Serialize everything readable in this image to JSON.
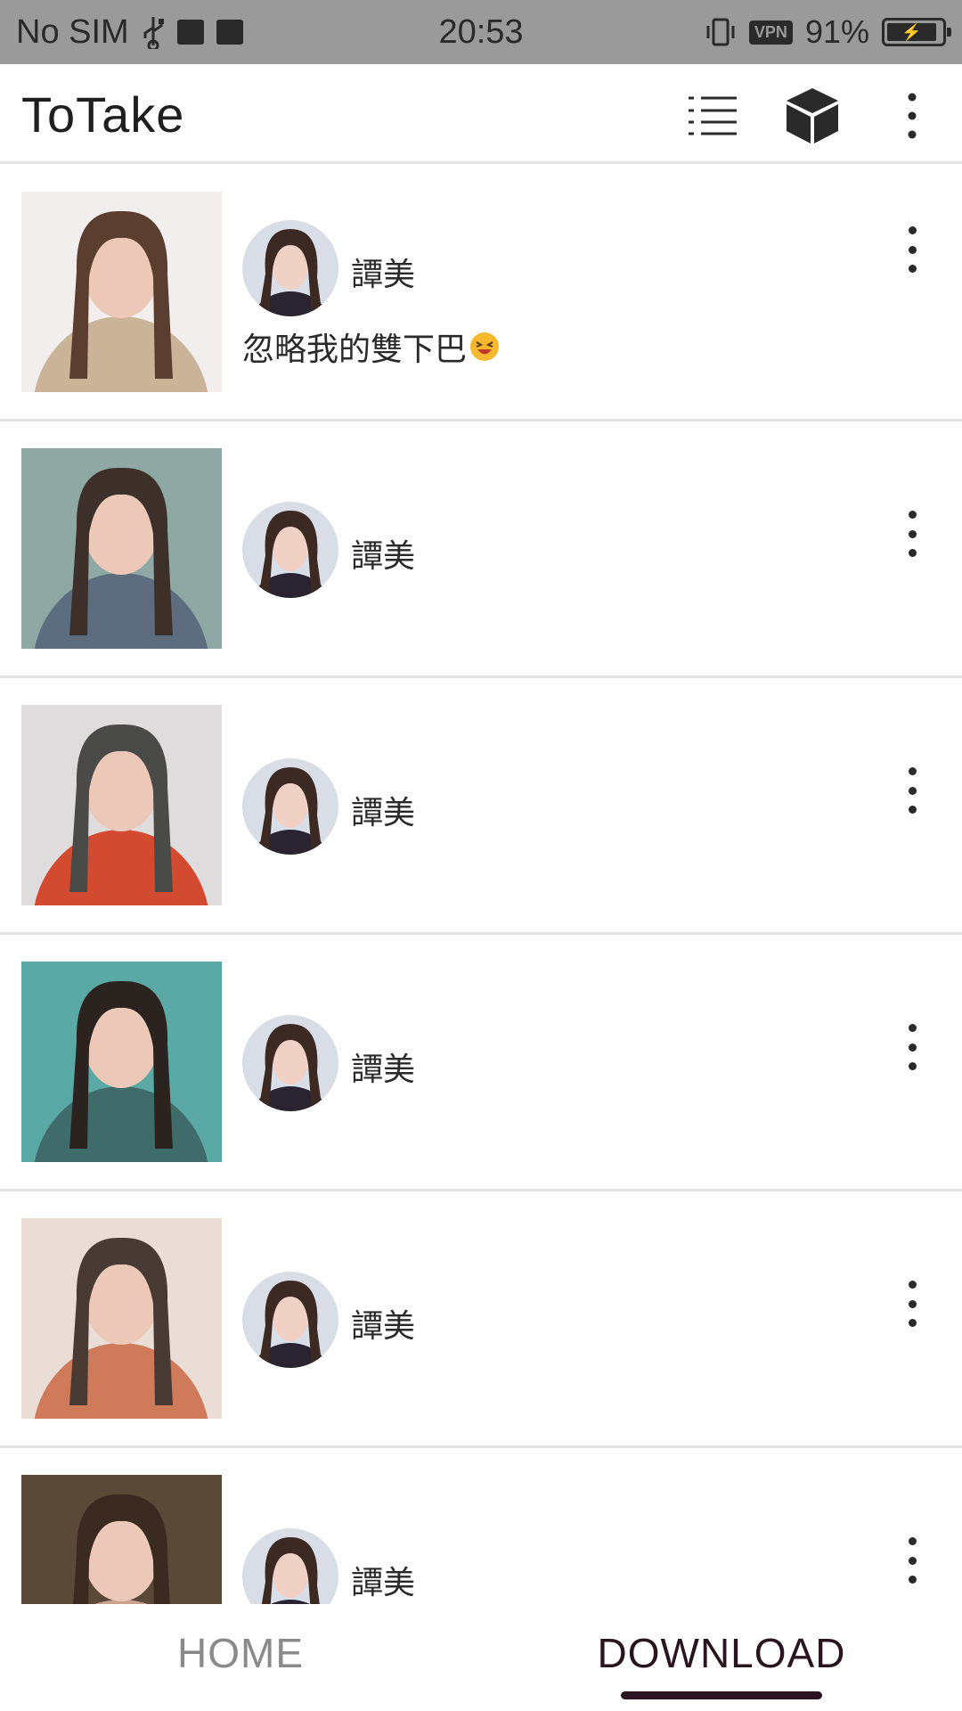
{
  "status_bar": {
    "carrier": "No SIM",
    "time": "20:53",
    "vpn": "VPN",
    "battery_percent_text": "91%",
    "battery_level": 0.91,
    "icons": [
      "usb-icon",
      "usb-debug-icon",
      "image-icon",
      "vibrate-icon",
      "vpn-icon",
      "battery-charging-icon"
    ]
  },
  "app_bar": {
    "title": "ToTake",
    "actions": [
      "list-view-icon",
      "cube-icon",
      "more-vert-icon"
    ]
  },
  "feed": {
    "items": [
      {
        "username": "譚美",
        "caption": "忽略我的雙下巴",
        "caption_emoji": "laughing-emoji",
        "thumb_palette": [
          "#f3eeee",
          "#c9b49a",
          "#5a3e30"
        ]
      },
      {
        "username": "譚美",
        "caption": "",
        "thumb_palette": [
          "#8fa8a4",
          "#5d6d7e",
          "#3d2f2a"
        ]
      },
      {
        "username": "譚美",
        "caption": "",
        "thumb_palette": [
          "#dedcdc",
          "#d24a2f",
          "#4a4a48"
        ]
      },
      {
        "username": "譚美",
        "caption": "",
        "thumb_palette": [
          "#5aa9a4",
          "#3f6b6a",
          "#2a2320"
        ]
      },
      {
        "username": "譚美",
        "caption": "",
        "thumb_palette": [
          "#e9ddd6",
          "#cf7a5a",
          "#4a3a34"
        ]
      },
      {
        "username": "譚美",
        "caption": "",
        "thumb_palette": [
          "#5a4838",
          "#c9a28e",
          "#3a2a22"
        ]
      }
    ]
  },
  "tabs": {
    "items": [
      "HOME",
      "DOWNLOAD"
    ],
    "active_index": 1
  },
  "colors": {
    "status_bar_bg": "#9a9a9a",
    "divider": "#e4e4e4",
    "tab_active": "#2a1420",
    "tab_inactive": "#8a8a8a"
  }
}
